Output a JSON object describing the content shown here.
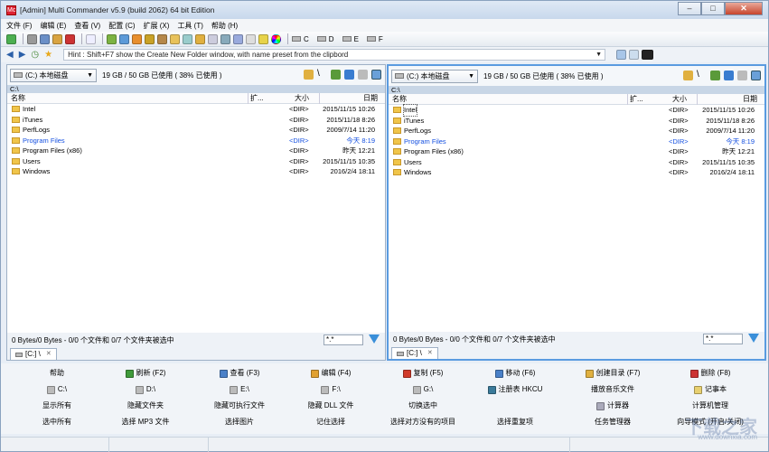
{
  "window": {
    "title": "[Admin] Multi Commander v5.9 (build 2062) 64 bit Edition",
    "icon_label": "Mc"
  },
  "menu": [
    "文件 (F)",
    "编辑 (E)",
    "查看 (V)",
    "配置 (C)",
    "扩展 (X)",
    "工具 (T)",
    "帮助 (H)"
  ],
  "toolbar_drives": [
    "C",
    "D",
    "E",
    "F"
  ],
  "hint": {
    "text": "Hint : Shift+F7 show the Create New Folder window, with name preset from the clipbord"
  },
  "panels": [
    {
      "drive": "(C:) 本地磁盘",
      "free": "19 GB / 50 GB 已使用 ( 38% 已使用 )",
      "path": "C:\\",
      "columns": {
        "name": "名称",
        "ext": "扩...",
        "size": "大小",
        "date": "日期"
      },
      "rows": [
        {
          "name": "Intel",
          "size": "<DIR>",
          "date": "2015/11/15 10:26",
          "blue": false
        },
        {
          "name": "iTunes",
          "size": "<DIR>",
          "date": "2015/11/18 8:26",
          "blue": false
        },
        {
          "name": "PerfLogs",
          "size": "<DIR>",
          "date": "2009/7/14 11:20",
          "blue": false
        },
        {
          "name": "Program Files",
          "size": "<DIR>",
          "date": "今天 8:19",
          "blue": true
        },
        {
          "name": "Program Files (x86)",
          "size": "<DIR>",
          "date": "昨天 12:21",
          "blue": false
        },
        {
          "name": "Users",
          "size": "<DIR>",
          "date": "2015/11/15 10:35",
          "blue": false
        },
        {
          "name": "Windows",
          "size": "<DIR>",
          "date": "2016/2/4 18:11",
          "blue": false
        }
      ],
      "status": "0 Bytes/0 Bytes - 0/0 个文件和 0/7 个文件夹被选中",
      "filter": "*.*",
      "tab": "[C:] \\"
    },
    {
      "drive": "(C:) 本地磁盘",
      "free": "19 GB / 50 GB 已使用 ( 38% 已使用 )",
      "path": "C:\\",
      "columns": {
        "name": "名称",
        "ext": "扩...",
        "size": "大小",
        "date": "日期"
      },
      "rows": [
        {
          "name": "Intel",
          "size": "<DIR>",
          "date": "2015/11/15 10:26",
          "blue": false
        },
        {
          "name": "iTunes",
          "size": "<DIR>",
          "date": "2015/11/18 8:26",
          "blue": false
        },
        {
          "name": "PerfLogs",
          "size": "<DIR>",
          "date": "2009/7/14 11:20",
          "blue": false
        },
        {
          "name": "Program Files",
          "size": "<DIR>",
          "date": "今天 8:19",
          "blue": true
        },
        {
          "name": "Program Files (x86)",
          "size": "<DIR>",
          "date": "昨天 12:21",
          "blue": false
        },
        {
          "name": "Users",
          "size": "<DIR>",
          "date": "2015/11/15 10:35",
          "blue": false
        },
        {
          "name": "Windows",
          "size": "<DIR>",
          "date": "2016/2/4 18:11",
          "blue": false
        }
      ],
      "status": "0 Bytes/0 Bytes - 0/0 个文件和 0/7 个文件夹被选中",
      "filter": "*.*",
      "tab": "[C:] \\"
    }
  ],
  "fkeys": [
    [
      "帮助",
      "刷新 (F2)",
      "查看 (F3)",
      "编辑 (F4)",
      "复制 (F5)",
      "移动 (F6)",
      "创建目录 (F7)",
      "删除 (F8)"
    ],
    [
      "C:\\",
      "D:\\",
      "E:\\",
      "F:\\",
      "G:\\",
      "注册表 HKCU",
      "播放音乐文件",
      "记事本"
    ],
    [
      "显示所有",
      "隐藏文件夹",
      "隐藏可执行文件",
      "隐藏 DLL 文件",
      "切换选中",
      "",
      "计算器",
      "计算机管理"
    ],
    [
      "选中所有",
      "选择 MP3 文件",
      "选择图片",
      "记住选择",
      "选择对方没有的项目",
      "选择重复项",
      "任务管理器",
      "向导模式 (开启/关闭)"
    ]
  ],
  "watermark": {
    "big": "下载之家",
    "small": "www.downxia.com"
  }
}
